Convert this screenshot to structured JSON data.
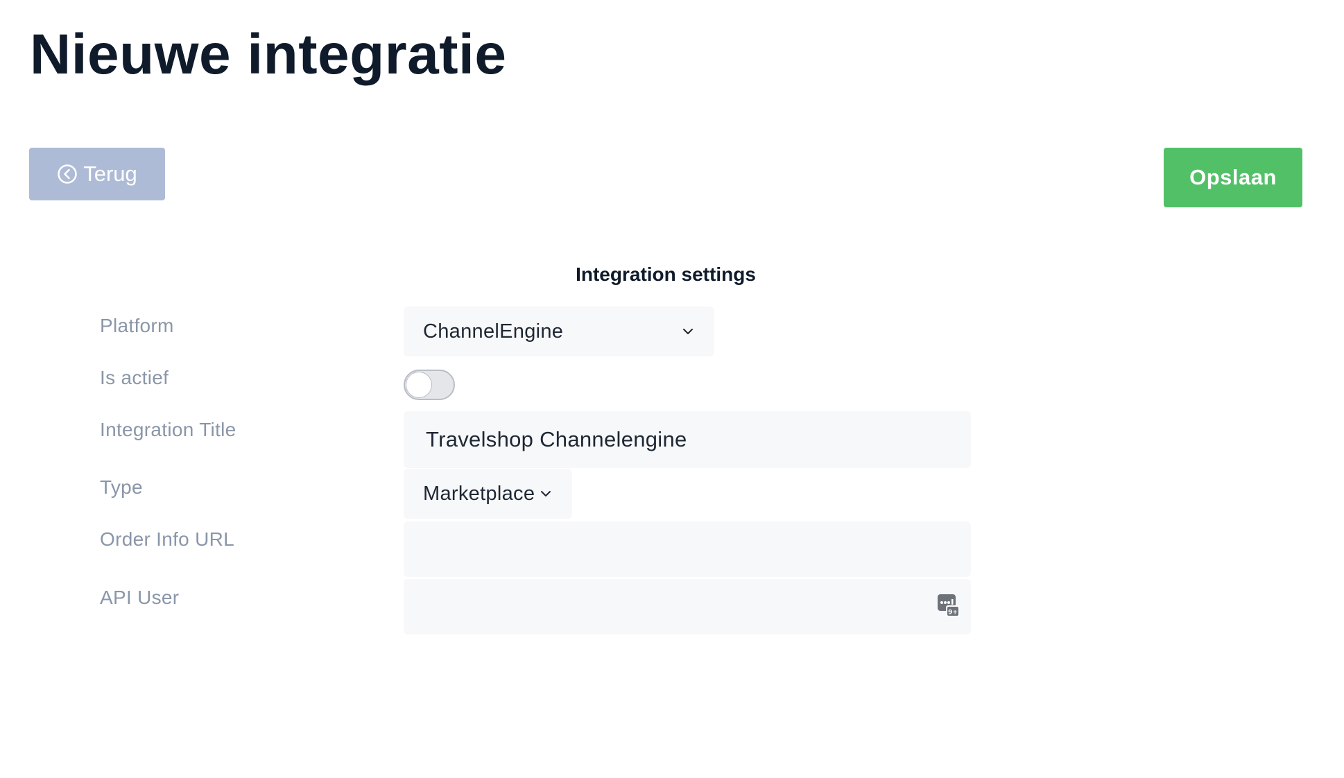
{
  "page": {
    "title": "Nieuwe integratie"
  },
  "toolbar": {
    "back_label": "Terug",
    "save_label": "Opslaan"
  },
  "section": {
    "title": "Integration settings"
  },
  "form": {
    "platform": {
      "label": "Platform",
      "value": "ChannelEngine"
    },
    "is_active": {
      "label": "Is actief",
      "checked": false
    },
    "integration_title": {
      "label": "Integration Title",
      "value": "Travelshop Channelengine"
    },
    "type": {
      "label": "Type",
      "value": "Marketplace"
    },
    "order_info_url": {
      "label": "Order Info URL",
      "value": ""
    },
    "api_user": {
      "label": "API User",
      "value": ""
    }
  },
  "colors": {
    "save_button": "#52c067",
    "back_button": "#aebbd6",
    "input_background": "#f7f8fa",
    "label": "#8a96a8"
  },
  "icons": {
    "back": "circle-chevron-left-icon",
    "dropdown": "chevron-down-icon",
    "password_manager": "password-manager-icon"
  }
}
